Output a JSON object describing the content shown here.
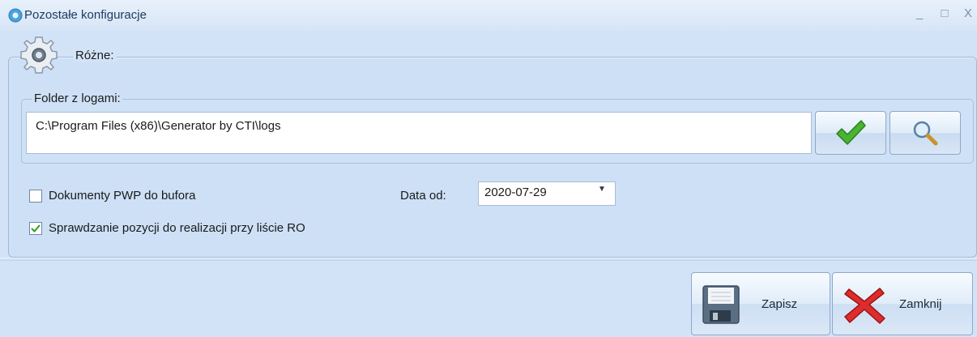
{
  "window": {
    "title": "Pozostałe konfiguracje",
    "minimize_label": "_",
    "maximize_label": "□",
    "close_label": "X"
  },
  "section": {
    "label": "Różne:"
  },
  "folder": {
    "legend": "Folder z logami:",
    "value": "C:\\Program Files (x86)\\Generator by CTI\\logs"
  },
  "options": {
    "pwp_to_buffer": {
      "label": "Dokumenty PWP do bufora",
      "checked": false
    },
    "check_positions": {
      "label": "Sprawdzanie pozycji do realizacji przy liście RO",
      "checked": true
    }
  },
  "date": {
    "label": "Data od:",
    "value": "2020-07-29"
  },
  "buttons": {
    "save_label": "Zapisz",
    "close_label": "Zamknij"
  },
  "icons": {
    "app": "gear-app-icon",
    "section": "gear-icon",
    "accept": "checkmark-icon",
    "browse": "magnifier-icon",
    "save": "floppy-icon",
    "close": "red-x-icon"
  },
  "colors": {
    "accent_green": "#3aa12a",
    "cancel_red": "#d62828",
    "panel_bg": "#d3e3f7"
  }
}
